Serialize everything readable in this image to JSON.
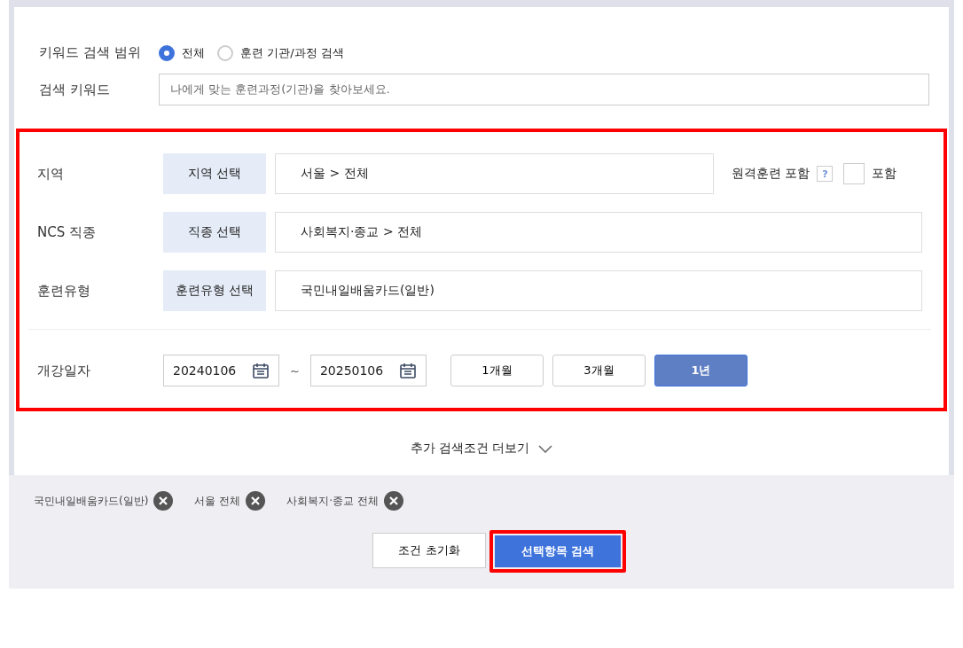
{
  "keyword_scope": {
    "label": "키워드 검색 범위",
    "options": [
      {
        "label": "전체",
        "selected": true
      },
      {
        "label": "훈련 기관/과정 검색",
        "selected": false
      }
    ]
  },
  "keyword": {
    "label": "검색 키워드",
    "placeholder": "나에게 맞는 훈련과정(기관)을 찾아보세요."
  },
  "filters": {
    "highlighted": true,
    "rows": [
      {
        "label": "지역",
        "button": "지역 선택",
        "value": "서울 > 전체"
      },
      {
        "label": "NCS 직종",
        "button": "직종 선택",
        "value": "사회복지·종교 > 전체"
      },
      {
        "label": "훈련유형",
        "button": "훈련유형 선택",
        "value": "국민내일배움카드(일반)"
      }
    ],
    "remote": {
      "label": "원격훈련 포함",
      "help": "?",
      "checked": false,
      "check_label": "포함"
    },
    "date": {
      "label": "개강일자",
      "from": "20240106",
      "separator": "~",
      "to": "20250106",
      "periods": [
        {
          "label": "1개월",
          "selected": false
        },
        {
          "label": "3개월",
          "selected": false
        },
        {
          "label": "1년",
          "selected": true
        }
      ]
    }
  },
  "more": "추가 검색조건 더보기",
  "tags": [
    {
      "label": "국민내일배움카드(일반)"
    },
    {
      "label": "서울 전체"
    },
    {
      "label": "사회복지·종교 전체"
    }
  ],
  "buttons": {
    "reset": {
      "label": "조건 초기화"
    },
    "search": {
      "label": "선택항목 검색",
      "highlighted": true
    }
  }
}
